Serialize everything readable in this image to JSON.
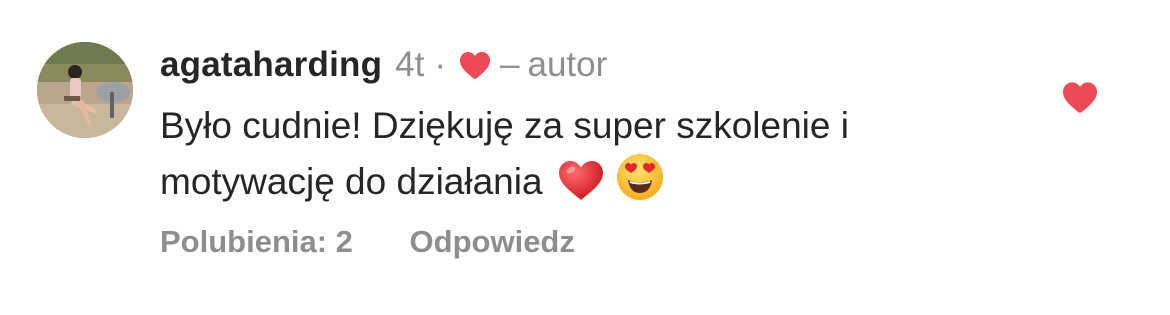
{
  "comment": {
    "username": "agataharding",
    "time": "4t",
    "separator_dot": "·",
    "separator_dash": "–",
    "author_label": "autor",
    "text_line1": "Było cudnie! Dziękuję za super szkolenie i",
    "text_line2": "motywację do działania",
    "likes_label": "Polubienia: 2",
    "reply_label": "Odpowiedz",
    "liked_by_author": true,
    "liked_by_viewer": true
  },
  "icons": {
    "author_like": "heart-icon",
    "like_button": "heart-icon",
    "emoji1": "red-heart-emoji",
    "emoji2": "heart-eyes-emoji"
  },
  "colors": {
    "heart": "#ED4956",
    "username": "#262626",
    "muted": "#8E8E8E",
    "text": "#262626"
  }
}
